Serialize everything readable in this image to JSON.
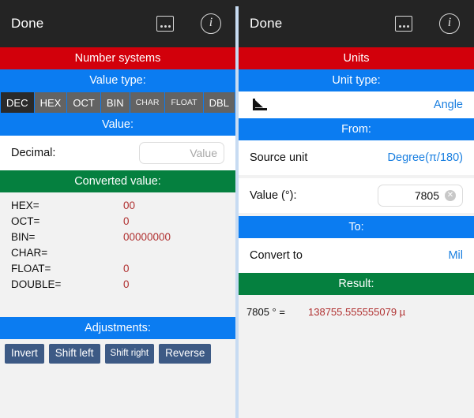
{
  "navbar": {
    "done_label": "Done",
    "dots_icon": "more-dots-icon",
    "info_icon": "info-circle-icon"
  },
  "colors": {
    "red": "#d2000b",
    "blue": "#0b7cf1",
    "green": "#05803f",
    "navbar": "#242424",
    "value_text": "#b03030",
    "link_text": "#1a7fe0",
    "button": "#3d5a85"
  },
  "left_panel": {
    "title": "Number systems",
    "value_type_header": "Value type:",
    "value_type_options": [
      {
        "label": "DEC",
        "selected": true,
        "small": false
      },
      {
        "label": "HEX",
        "selected": false,
        "small": false
      },
      {
        "label": "OCT",
        "selected": false,
        "small": false
      },
      {
        "label": "BIN",
        "selected": false,
        "small": false
      },
      {
        "label": "CHAR",
        "selected": false,
        "small": true
      },
      {
        "label": "FLOAT",
        "selected": false,
        "small": true
      },
      {
        "label": "DBL",
        "selected": false,
        "small": false
      }
    ],
    "value_header": "Value:",
    "decimal_label": "Decimal:",
    "decimal_placeholder": "Value",
    "decimal_value": "",
    "converted_header": "Converted value:",
    "converted_rows": [
      {
        "key": "HEX=",
        "value": "00"
      },
      {
        "key": "OCT=",
        "value": "0"
      },
      {
        "key": "BIN=",
        "value": "00000000"
      },
      {
        "key": "CHAR=",
        "value": ""
      },
      {
        "key": "FLOAT=",
        "value": "0"
      },
      {
        "key": "DOUBLE=",
        "value": "0"
      }
    ],
    "adjustments_header": "Adjustments:",
    "adjustment_buttons": [
      {
        "label": "Invert",
        "small": false
      },
      {
        "label": "Shift left",
        "small": false
      },
      {
        "label": "Shift right",
        "small": true
      },
      {
        "label": "Reverse",
        "small": false
      }
    ]
  },
  "right_panel": {
    "title": "Units",
    "unit_type_header": "Unit type:",
    "unit_type_icon": "angle-icon",
    "unit_type_value": "Angle",
    "from_header": "From:",
    "source_unit_label": "Source unit",
    "source_unit_value": "Degree(π/180)",
    "value_label": "Value (°):",
    "value_input": "7805",
    "clear_icon": "clear-circle-icon",
    "to_header": "To:",
    "convert_to_label": "Convert to",
    "convert_to_value": "Mil",
    "result_header": "Result:",
    "result_expression": "7805 ° =",
    "result_value": "138755.555555079 µ"
  }
}
